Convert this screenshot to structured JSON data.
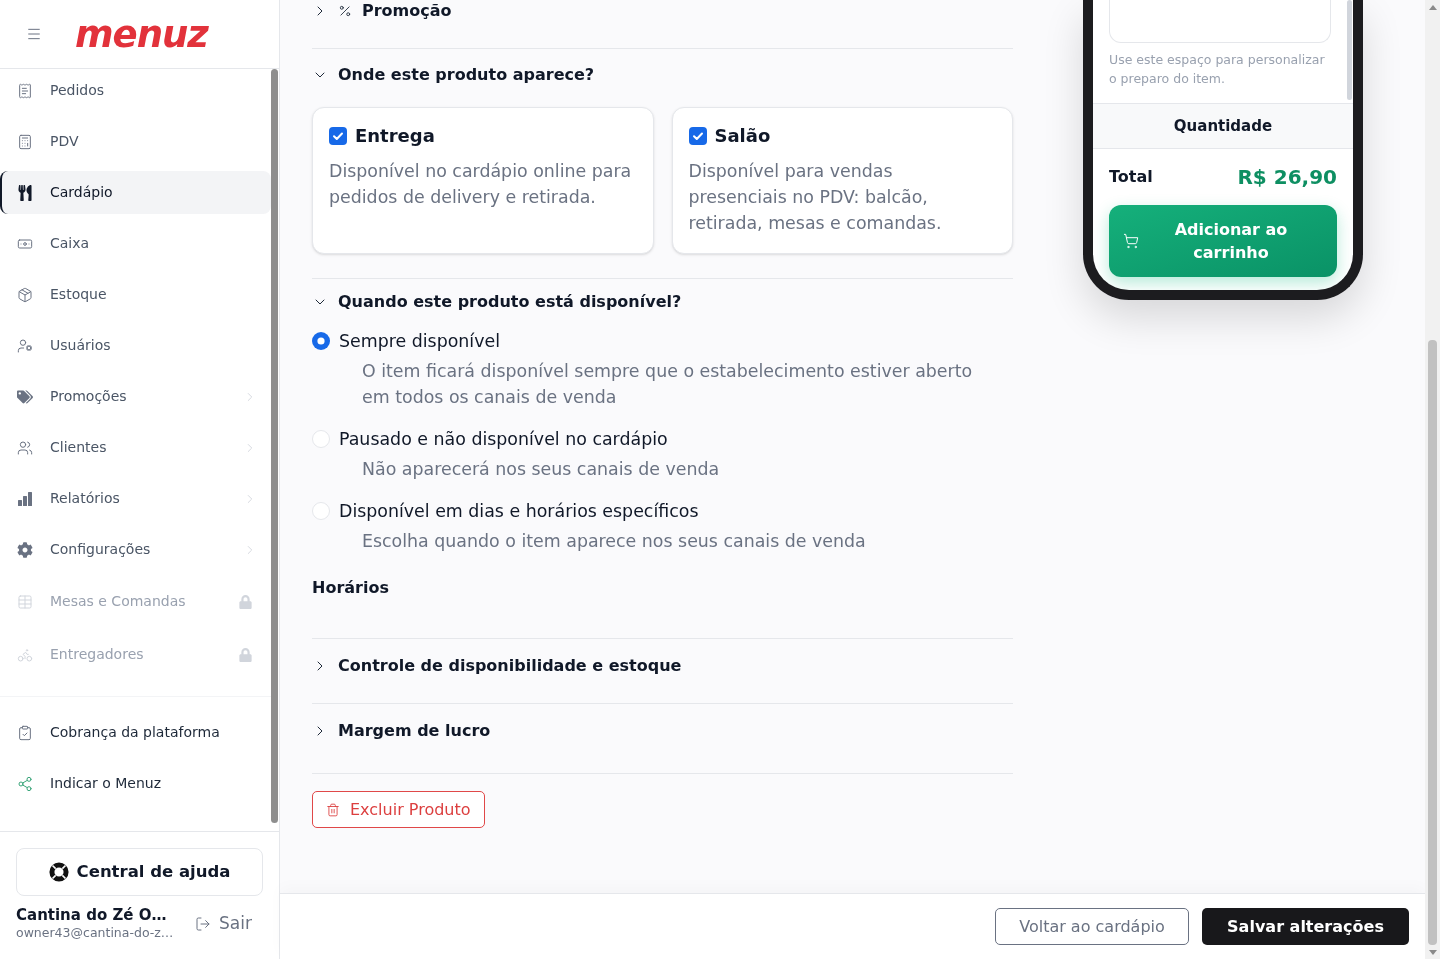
{
  "sidebar": {
    "logo": "menuz",
    "nav_items": [
      {
        "label": "Pedidos",
        "kind": "link",
        "selected": false
      },
      {
        "label": "PDV",
        "kind": "link",
        "selected": false
      },
      {
        "label": "Cardápio",
        "kind": "link",
        "selected": true
      },
      {
        "label": "Caixa",
        "kind": "link",
        "selected": false
      },
      {
        "label": "Estoque",
        "kind": "link",
        "selected": false
      },
      {
        "label": "Usuários",
        "kind": "link",
        "selected": false
      },
      {
        "label": "Promoções",
        "kind": "submenu",
        "selected": false
      },
      {
        "label": "Clientes",
        "kind": "submenu",
        "selected": false
      },
      {
        "label": "Relatórios",
        "kind": "submenu",
        "selected": false
      },
      {
        "label": "Configurações",
        "kind": "submenu",
        "selected": false
      },
      {
        "label": "Mesas e Comandas",
        "kind": "locked",
        "selected": false
      },
      {
        "label": "Entregadores",
        "kind": "locked",
        "selected": false
      }
    ],
    "secondary_items": [
      {
        "label": "Cobrança da plataforma",
        "selected": false
      },
      {
        "label": "Indicar o Menuz",
        "selected": false
      }
    ],
    "help_button": "Central de ajuda",
    "account": {
      "name": "Cantina do Zé O…",
      "email": "owner43@cantina-do-z…",
      "logout": "Sair"
    }
  },
  "sections": [
    {
      "kind": "promotion",
      "title": "Promoção",
      "expanded": false
    },
    {
      "kind": "channels",
      "title": "Onde este produto aparece?",
      "expanded": true,
      "channels": [
        {
          "label": "Entrega",
          "checked": true,
          "description": "Disponível no cardápio online para pedidos de delivery e retirada."
        },
        {
          "label": "Salão",
          "checked": true,
          "description": "Disponível para vendas presenciais no PDV: balcão, retirada, mesas e comandas."
        }
      ]
    },
    {
      "kind": "availability",
      "title": "Quando este produto está disponível?",
      "expanded": true,
      "options": [
        {
          "label": "Sempre disponível",
          "description": "O item ficará disponível sempre que o estabelecimento estiver aberto em todos os canais de venda",
          "selected": true
        },
        {
          "label": "Pausado e não disponível no cardápio",
          "description": "Não aparecerá nos seus canais de venda",
          "selected": false
        },
        {
          "label": "Disponível em dias e horários específicos",
          "description": "Escolha quando o item aparece nos seus canais de venda",
          "selected": false
        }
      ],
      "schedule_title": "Horários"
    },
    {
      "kind": "plain",
      "title": "Controle de disponibilidade e estoque",
      "expanded": false
    },
    {
      "kind": "plain",
      "title": "Margem de lucro",
      "expanded": false
    }
  ],
  "delete_button": "Excluir Produto",
  "preview": {
    "notes_hint": "Use este espaço para personalizar o preparo do item.",
    "quantity_label": "Quantidade",
    "total_label": "Total",
    "total_value": "R$ 26,90",
    "add_button": "Adicionar ao carrinho"
  },
  "actions": [
    {
      "label": "Voltar ao cardápio",
      "kind": "secondary"
    },
    {
      "label": "Salvar alterações",
      "kind": "primary"
    }
  ]
}
